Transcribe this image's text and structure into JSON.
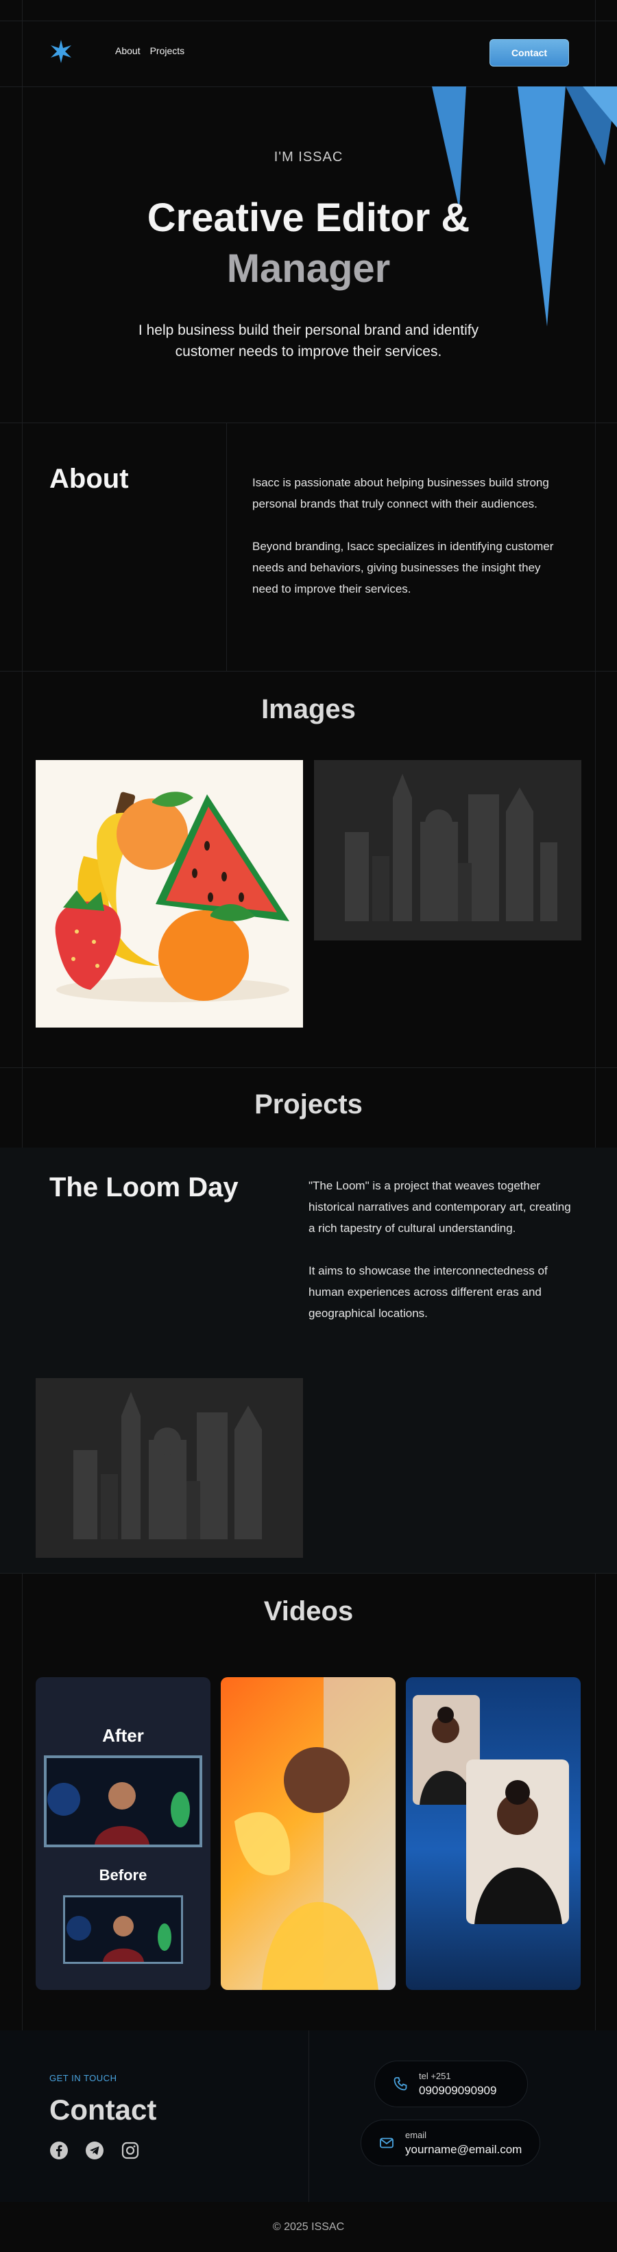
{
  "nav": {
    "links": [
      "About",
      "Projects"
    ],
    "contact_label": "Contact"
  },
  "hero": {
    "pre_title": "I'M ISSAC",
    "title_line1": "Creative Editor &",
    "title_line2": "Manager",
    "subtitle": "I help business build their personal brand and identify customer needs to improve their services."
  },
  "about": {
    "title": "About",
    "paragraphs": [
      "Isacc is passionate about helping businesses build strong personal brands that truly connect with their audiences.",
      "Beyond branding, Isacc specializes in identifying customer needs and behaviors, giving businesses the insight they need to improve their services."
    ]
  },
  "images": {
    "title": "Images"
  },
  "projects": {
    "title": "Projects",
    "item": {
      "title": "The Loom Day",
      "paragraphs": [
        "\"The Loom\" is a project that weaves together historical narratives and contemporary art, creating a rich tapestry of cultural understanding.",
        "It aims to showcase the interconnectedness of human experiences across different eras and geographical locations."
      ]
    }
  },
  "videos": {
    "title": "Videos",
    "after_label": "After",
    "before_label": "Before"
  },
  "contact": {
    "eyebrow": "GET IN TOUCH",
    "title": "Contact",
    "phone_label": "tel +251",
    "phone_value": "090909090909",
    "email_label": "email",
    "email_value": "yourname@email.com",
    "socials": [
      "facebook-icon",
      "telegram-icon",
      "instagram-icon"
    ]
  },
  "footer": {
    "copyright": "© 2025 ISSAC"
  },
  "colors": {
    "accent": "#4aa4e0",
    "background": "#0a0a0a"
  }
}
